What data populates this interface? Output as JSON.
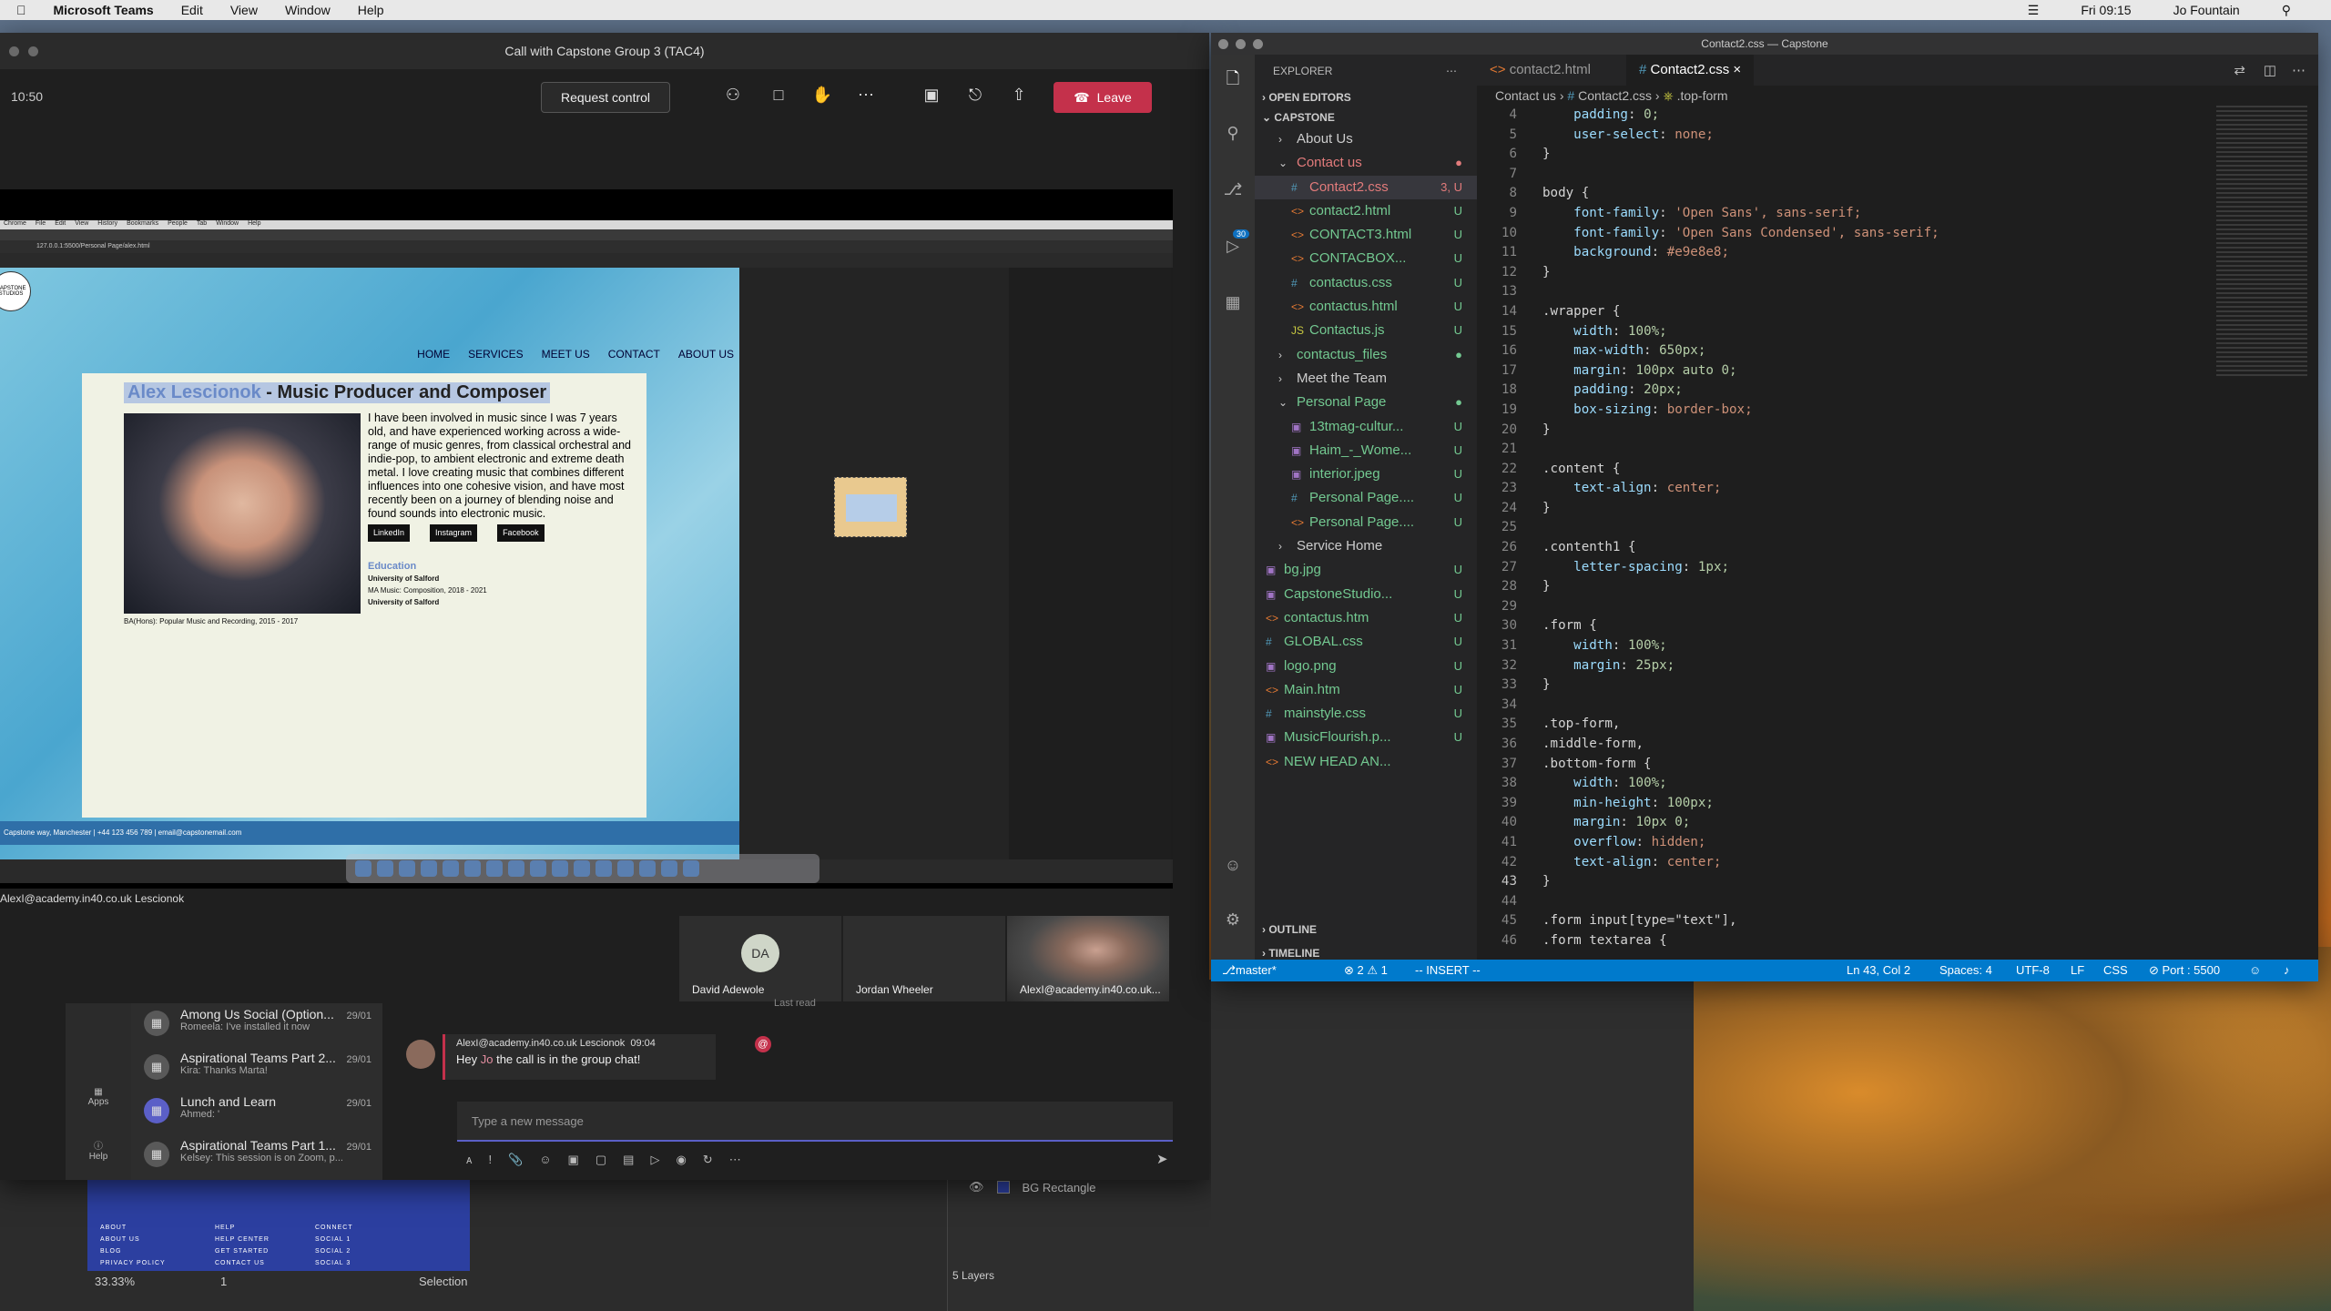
{
  "menubar": {
    "app": "Microsoft Teams",
    "items": [
      "Edit",
      "View",
      "Window",
      "Help"
    ],
    "clock": "Fri 09:15",
    "user": "Jo Fountain"
  },
  "teams": {
    "title": "Call with Capstone Group 3 (TAC4)",
    "call_time": "10:50",
    "request_control": "Request control",
    "leave": "Leave",
    "presenter_label": "AlexI@academy.in40.co.uk Lescionok",
    "tiles": [
      {
        "initials": "DA",
        "name": "David Adewole"
      },
      {
        "name": "Jordan Wheeler"
      },
      {
        "name": "AlexI@academy.in40.co.uk..."
      }
    ],
    "shared": {
      "browser_menu": [
        "Chrome",
        "File",
        "Edit",
        "View",
        "History",
        "Bookmarks",
        "People",
        "Tab",
        "Window",
        "Help"
      ],
      "url": "127.0.0.1:5500/Personal Page/alex.html",
      "logo": "CAPSTONE STUDIOS",
      "nav": [
        "HOME",
        "SERVICES",
        "MEET US",
        "CONTACT",
        "ABOUT US"
      ],
      "heading_name": "Alex Lescionok",
      "heading_rest": " - Music Producer and Composer",
      "bio": "I have been involved in music since I was 7 years old, and have experienced working across a wide-range of music genres, from classical orchestral and indie-pop, to ambient electronic and extreme death metal. I love creating music that combines different influences into one cohesive vision, and have most recently been on a journey of blending noise and found sounds into electronic music.",
      "social": [
        "LinkedIn",
        "Instagram",
        "Facebook"
      ],
      "edu_heading": "Education",
      "edu": [
        "University of Salford",
        "MA Music: Composition, 2018 - 2021",
        "University of Salford"
      ],
      "edu_ba": "BA(Hons): Popular Music and Recording, 2015 - 2017",
      "footer": "Capstone way, Manchester | +44 123 456 789 | email@capstonemail.com"
    }
  },
  "chat": {
    "rail": [
      {
        "label": "Apps"
      },
      {
        "label": "Help"
      }
    ],
    "list": [
      {
        "title": "Among Us Social (Option...",
        "sub": "Romeela: I've installed it now",
        "date": "29/01"
      },
      {
        "title": "Aspirational Teams Part 2...",
        "sub": "Kira: Thanks Marta!",
        "date": "29/01"
      },
      {
        "title": "Lunch and Learn",
        "sub": "Ahmed: '",
        "date": "29/01"
      },
      {
        "title": "Aspirational Teams Part 1...",
        "sub": "Kelsey: This session is on Zoom, p...",
        "date": "29/01"
      }
    ],
    "last_read": "Last read",
    "message": {
      "author": "AlexI@academy.in40.co.uk Lescionok",
      "time": "09:04",
      "text_pre": "Hey ",
      "mention": "Jo",
      "text_post": " the call is in the group chat!"
    },
    "composer_placeholder": "Type a new message"
  },
  "figma": {
    "footer_cols": [
      [
        "ABOUT",
        "ABOUT US",
        "BLOG",
        "PRIVACY POLICY"
      ],
      [
        "HELP",
        "HELP CENTER",
        "GET STARTED",
        "CONTACT US"
      ],
      [
        "CONNECT",
        "SOCIAL 1",
        "SOCIAL 2",
        "SOCIAL 3"
      ]
    ],
    "zoom": "33.33%",
    "page": "1",
    "mode": "Selection",
    "layer_name": "BG Rectangle",
    "layers_count": "5 Layers"
  },
  "vscode": {
    "title": "Contact2.css — Capstone",
    "explorer": "EXPLORER",
    "open_editors": "OPEN EDITORS",
    "root": "CAPSTONE",
    "outline": "OUTLINE",
    "timeline": "TIMELINE",
    "tree": [
      {
        "name": "About Us",
        "indent": 1,
        "type": "folder",
        "status": ""
      },
      {
        "name": "Contact us",
        "indent": 1,
        "type": "folder-open",
        "status": "●",
        "color": "#e27b7b"
      },
      {
        "name": "Contact2.css",
        "indent": 2,
        "type": "css",
        "status": "3, U",
        "color": "#e27b7b",
        "selected": true
      },
      {
        "name": "contact2.html",
        "indent": 2,
        "type": "html",
        "status": "U",
        "color": "#73c991"
      },
      {
        "name": "CONTACT3.html",
        "indent": 2,
        "type": "html",
        "status": "U",
        "color": "#73c991"
      },
      {
        "name": "CONTACBOX...",
        "indent": 2,
        "type": "html",
        "status": "U",
        "color": "#73c991"
      },
      {
        "name": "contactus.css",
        "indent": 2,
        "type": "css",
        "status": "U",
        "color": "#73c991"
      },
      {
        "name": "contactus.html",
        "indent": 2,
        "type": "html",
        "status": "U",
        "color": "#73c991"
      },
      {
        "name": "Contactus.js",
        "indent": 2,
        "type": "js",
        "status": "U",
        "color": "#73c991"
      },
      {
        "name": "contactus_files",
        "indent": 1,
        "type": "folder",
        "status": "●",
        "color": "#73c991"
      },
      {
        "name": "Meet the Team",
        "indent": 1,
        "type": "folder",
        "status": ""
      },
      {
        "name": "Personal Page",
        "indent": 1,
        "type": "folder-open",
        "status": "●",
        "color": "#73c991"
      },
      {
        "name": "13tmag-cultur...",
        "indent": 2,
        "type": "img",
        "status": "U",
        "color": "#73c991"
      },
      {
        "name": "Haim_-_Wome...",
        "indent": 2,
        "type": "img",
        "status": "U",
        "color": "#73c991"
      },
      {
        "name": "interior.jpeg",
        "indent": 2,
        "type": "img",
        "status": "U",
        "color": "#73c991"
      },
      {
        "name": "Personal Page....",
        "indent": 2,
        "type": "css",
        "status": "U",
        "color": "#73c991"
      },
      {
        "name": "Personal Page....",
        "indent": 2,
        "type": "html",
        "status": "U",
        "color": "#73c991"
      },
      {
        "name": "Service Home",
        "indent": 1,
        "type": "folder",
        "status": ""
      },
      {
        "name": "bg.jpg",
        "indent": 0,
        "type": "img",
        "status": "U",
        "color": "#73c991"
      },
      {
        "name": "CapstoneStudio...",
        "indent": 0,
        "type": "img",
        "status": "U",
        "color": "#73c991"
      },
      {
        "name": "contactus.htm",
        "indent": 0,
        "type": "html",
        "status": "U",
        "color": "#73c991"
      },
      {
        "name": "GLOBAL.css",
        "indent": 0,
        "type": "css",
        "status": "U",
        "color": "#73c991"
      },
      {
        "name": "logo.png",
        "indent": 0,
        "type": "img",
        "status": "U",
        "color": "#73c991"
      },
      {
        "name": "Main.htm",
        "indent": 0,
        "type": "html",
        "status": "U",
        "color": "#73c991"
      },
      {
        "name": "mainstyle.css",
        "indent": 0,
        "type": "css",
        "status": "U",
        "color": "#73c991"
      },
      {
        "name": "MusicFlourish.p...",
        "indent": 0,
        "type": "img",
        "status": "U",
        "color": "#73c991"
      },
      {
        "name": "NEW HEAD AN...",
        "indent": 0,
        "type": "html",
        "status": "",
        "color": "#73c991"
      }
    ],
    "tabs": [
      "contact2.html",
      "Contact2.css"
    ],
    "breadcrumb": [
      "Contact us",
      "Contact2.css",
      ".top-form"
    ],
    "code": [
      {
        "n": "4",
        "t": "    padding: 0;"
      },
      {
        "n": "5",
        "t": "    user-select: none;"
      },
      {
        "n": "6",
        "t": "}"
      },
      {
        "n": "7",
        "t": ""
      },
      {
        "n": "8",
        "t": "body {"
      },
      {
        "n": "9",
        "t": "    font-family: 'Open Sans', sans-serif;"
      },
      {
        "n": "10",
        "t": "    font-family: 'Open Sans Condensed', sans-serif;"
      },
      {
        "n": "11",
        "t": "    background: #e9e8e8;"
      },
      {
        "n": "12",
        "t": "}"
      },
      {
        "n": "13",
        "t": ""
      },
      {
        "n": "14",
        "t": ".wrapper {"
      },
      {
        "n": "15",
        "t": "    width: 100%;"
      },
      {
        "n": "16",
        "t": "    max-width: 650px;"
      },
      {
        "n": "17",
        "t": "    margin: 100px auto 0;"
      },
      {
        "n": "18",
        "t": "    padding: 20px;"
      },
      {
        "n": "19",
        "t": "    box-sizing: border-box;"
      },
      {
        "n": "20",
        "t": "}"
      },
      {
        "n": "21",
        "t": ""
      },
      {
        "n": "22",
        "t": ".content {"
      },
      {
        "n": "23",
        "t": "    text-align: center;"
      },
      {
        "n": "24",
        "t": "}"
      },
      {
        "n": "25",
        "t": ""
      },
      {
        "n": "26",
        "t": ".contenth1 {"
      },
      {
        "n": "27",
        "t": "    letter-spacing: 1px;"
      },
      {
        "n": "28",
        "t": "}"
      },
      {
        "n": "29",
        "t": ""
      },
      {
        "n": "30",
        "t": ".form {"
      },
      {
        "n": "31",
        "t": "    width: 100%;"
      },
      {
        "n": "32",
        "t": "    margin: 25px;"
      },
      {
        "n": "33",
        "t": "}"
      },
      {
        "n": "34",
        "t": ""
      },
      {
        "n": "35",
        "t": ".top-form,"
      },
      {
        "n": "36",
        "t": ".middle-form,"
      },
      {
        "n": "37",
        "t": ".bottom-form {"
      },
      {
        "n": "38",
        "t": "    width: 100%;"
      },
      {
        "n": "39",
        "t": "    min-height: 100px;"
      },
      {
        "n": "40",
        "t": "    margin: 10px 0;"
      },
      {
        "n": "41",
        "t": "    overflow: hidden;"
      },
      {
        "n": "42",
        "t": "    text-align: center;"
      },
      {
        "n": "43",
        "t": "}"
      },
      {
        "n": "44",
        "t": ""
      },
      {
        "n": "45",
        "t": ".form input[type=\"text\"],"
      },
      {
        "n": "46",
        "t": ".form textarea {"
      }
    ],
    "status": {
      "branch": "master*",
      "problems": "⊗ 2 ⚠ 1",
      "mode": "-- INSERT --",
      "position": "Ln 43, Col 2",
      "spaces": "Spaces: 4",
      "encoding": "UTF-8",
      "eol": "LF",
      "lang": "CSS",
      "port": "⊘ Port : 5500"
    },
    "scm_badge": "30"
  }
}
